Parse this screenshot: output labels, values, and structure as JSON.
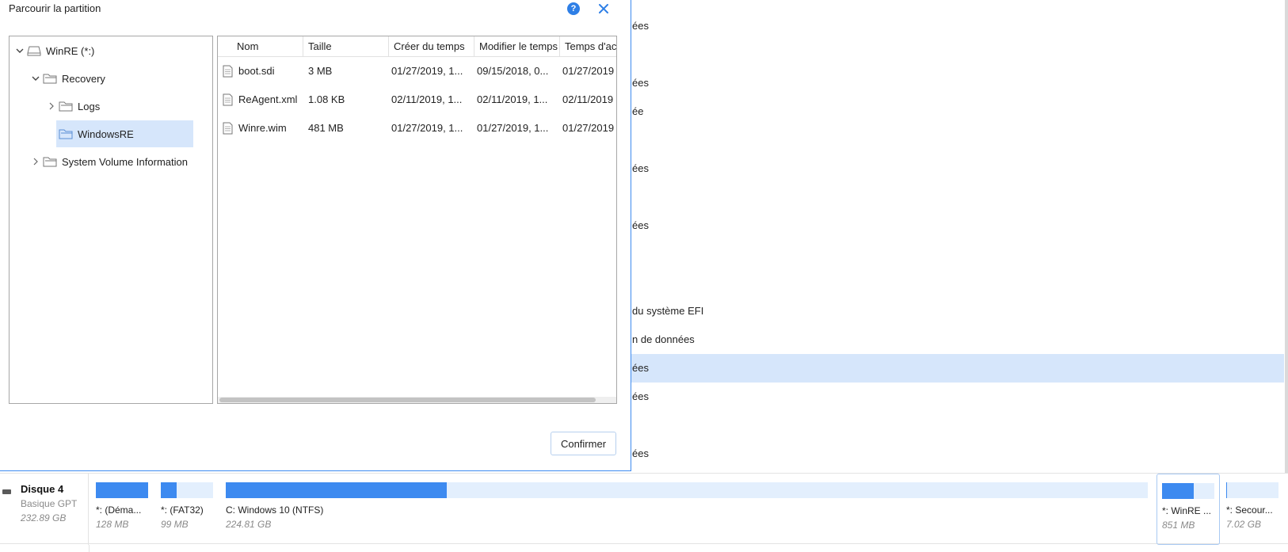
{
  "dialog": {
    "title": "Parcourir la partition",
    "help_label": "?",
    "confirm_label": "Confirmer"
  },
  "tree": [
    {
      "label": "WinRE (*:)",
      "icon": "drive-icon",
      "expanded": true
    },
    {
      "label": "Recovery",
      "icon": "folder-icon",
      "expanded": true
    },
    {
      "label": "Logs",
      "icon": "folder-icon",
      "expanded": false
    },
    {
      "label": "WindowsRE",
      "icon": "folder-icon",
      "selected": true
    },
    {
      "label": "System Volume Information",
      "icon": "folder-icon",
      "expanded": false
    }
  ],
  "files": {
    "columns": [
      "Nom",
      "Taille",
      "Créer du temps",
      "Modifier le temps",
      "Temps d'accès"
    ],
    "rows": [
      {
        "name": "boot.sdi",
        "size": "3 MB",
        "created": "01/27/2019, 1...",
        "modified": "09/15/2018, 0...",
        "accessed": "01/27/2019"
      },
      {
        "name": "ReAgent.xml",
        "size": "1.08 KB",
        "created": "02/11/2019, 1...",
        "modified": "02/11/2019, 1...",
        "accessed": "02/11/2019"
      },
      {
        "name": "Winre.wim",
        "size": "481 MB",
        "created": "01/27/2019, 1...",
        "modified": "01/27/2019, 1...",
        "accessed": "01/27/2019"
      }
    ]
  },
  "background_rows": [
    {
      "text": "ées"
    },
    {
      "text": "ées"
    },
    {
      "text": "ée"
    },
    {
      "text": "ées"
    },
    {
      "text": "ées"
    },
    {
      "text": "du système EFI"
    },
    {
      "text": "n de données"
    },
    {
      "text": "ées",
      "selected": true
    },
    {
      "text": "ées"
    },
    {
      "text": "ées"
    }
  ],
  "disk": {
    "name": "Disque 4",
    "type": "Basique GPT",
    "size": "232.89 GB",
    "partitions": [
      {
        "label": "*:  (Déma...",
        "size": "128 MB",
        "used_fraction": 1.0
      },
      {
        "label": "*:  (FAT32)",
        "size": "99 MB",
        "used_fraction": 0.3
      },
      {
        "label": "C: Windows 10 (NTFS)",
        "size": "224.81 GB",
        "used_fraction": 0.24
      },
      {
        "label": "*: WinRE ...",
        "size": "851 MB",
        "used_fraction": 0.6,
        "selected": true
      },
      {
        "label": "*: Secour...",
        "size": "7.02 GB",
        "used_fraction": 0.01
      }
    ]
  },
  "colors": {
    "accent": "#3d8af0",
    "selection": "#d6e6fb",
    "help": "#2e7fe6"
  }
}
